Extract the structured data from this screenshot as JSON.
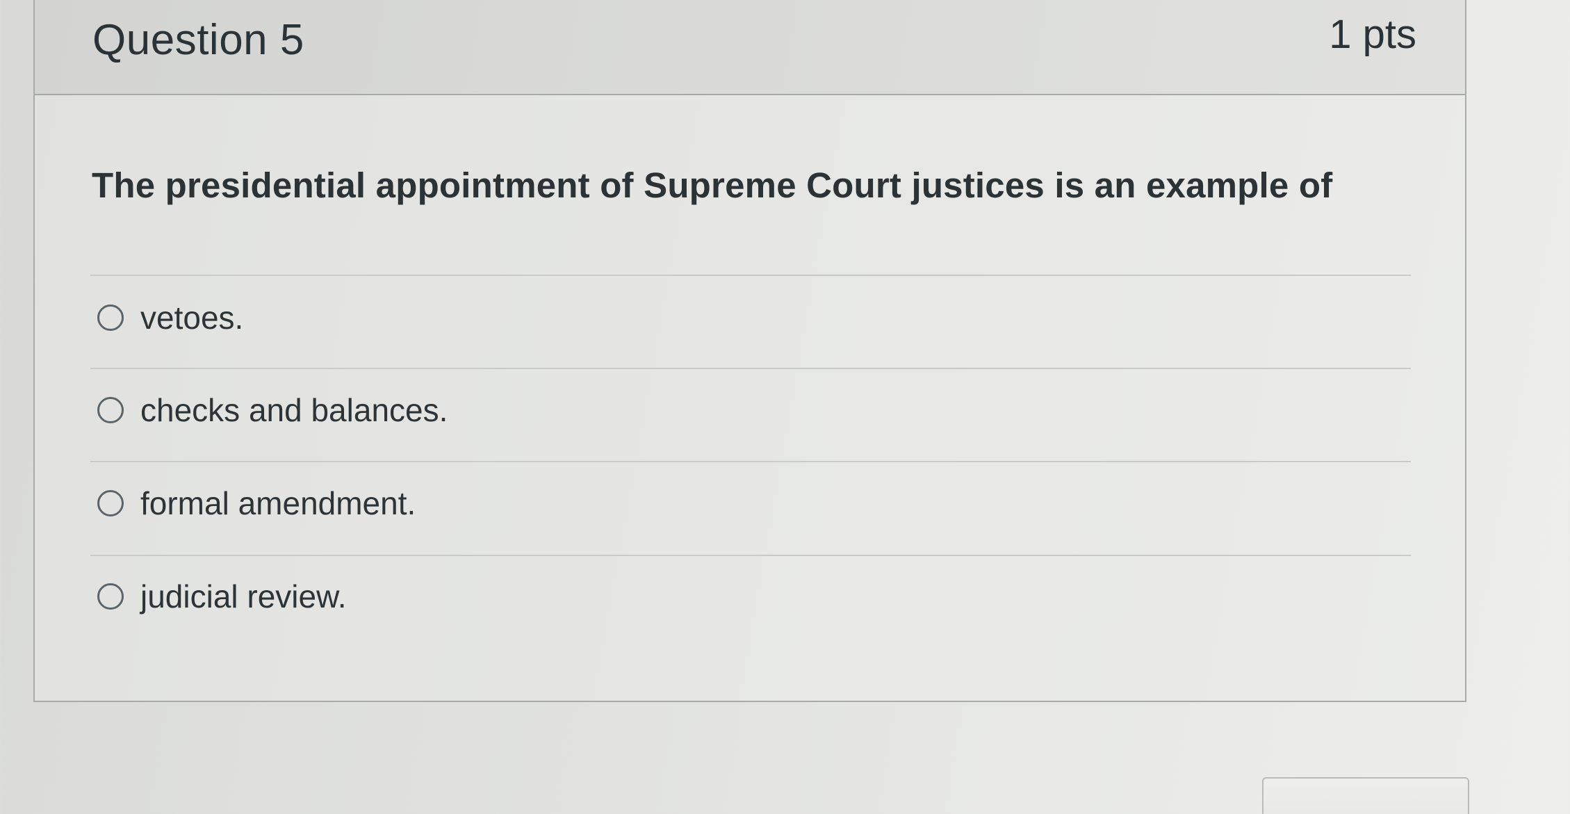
{
  "question": {
    "title": "Question 5",
    "points": "1 pts",
    "text": "The presidential appointment of Supreme Court justices is an example of"
  },
  "answers": [
    {
      "label": "vetoes.",
      "selected": false
    },
    {
      "label": "checks and balances.",
      "selected": false
    },
    {
      "label": "formal amendment.",
      "selected": false
    },
    {
      "label": "judicial review.",
      "selected": false
    }
  ],
  "colors": {
    "text": "#2d3438",
    "border": "#a7abaa",
    "header_bg": "#d9dad8"
  },
  "icons": {
    "radio": "radio-unchecked-icon"
  }
}
